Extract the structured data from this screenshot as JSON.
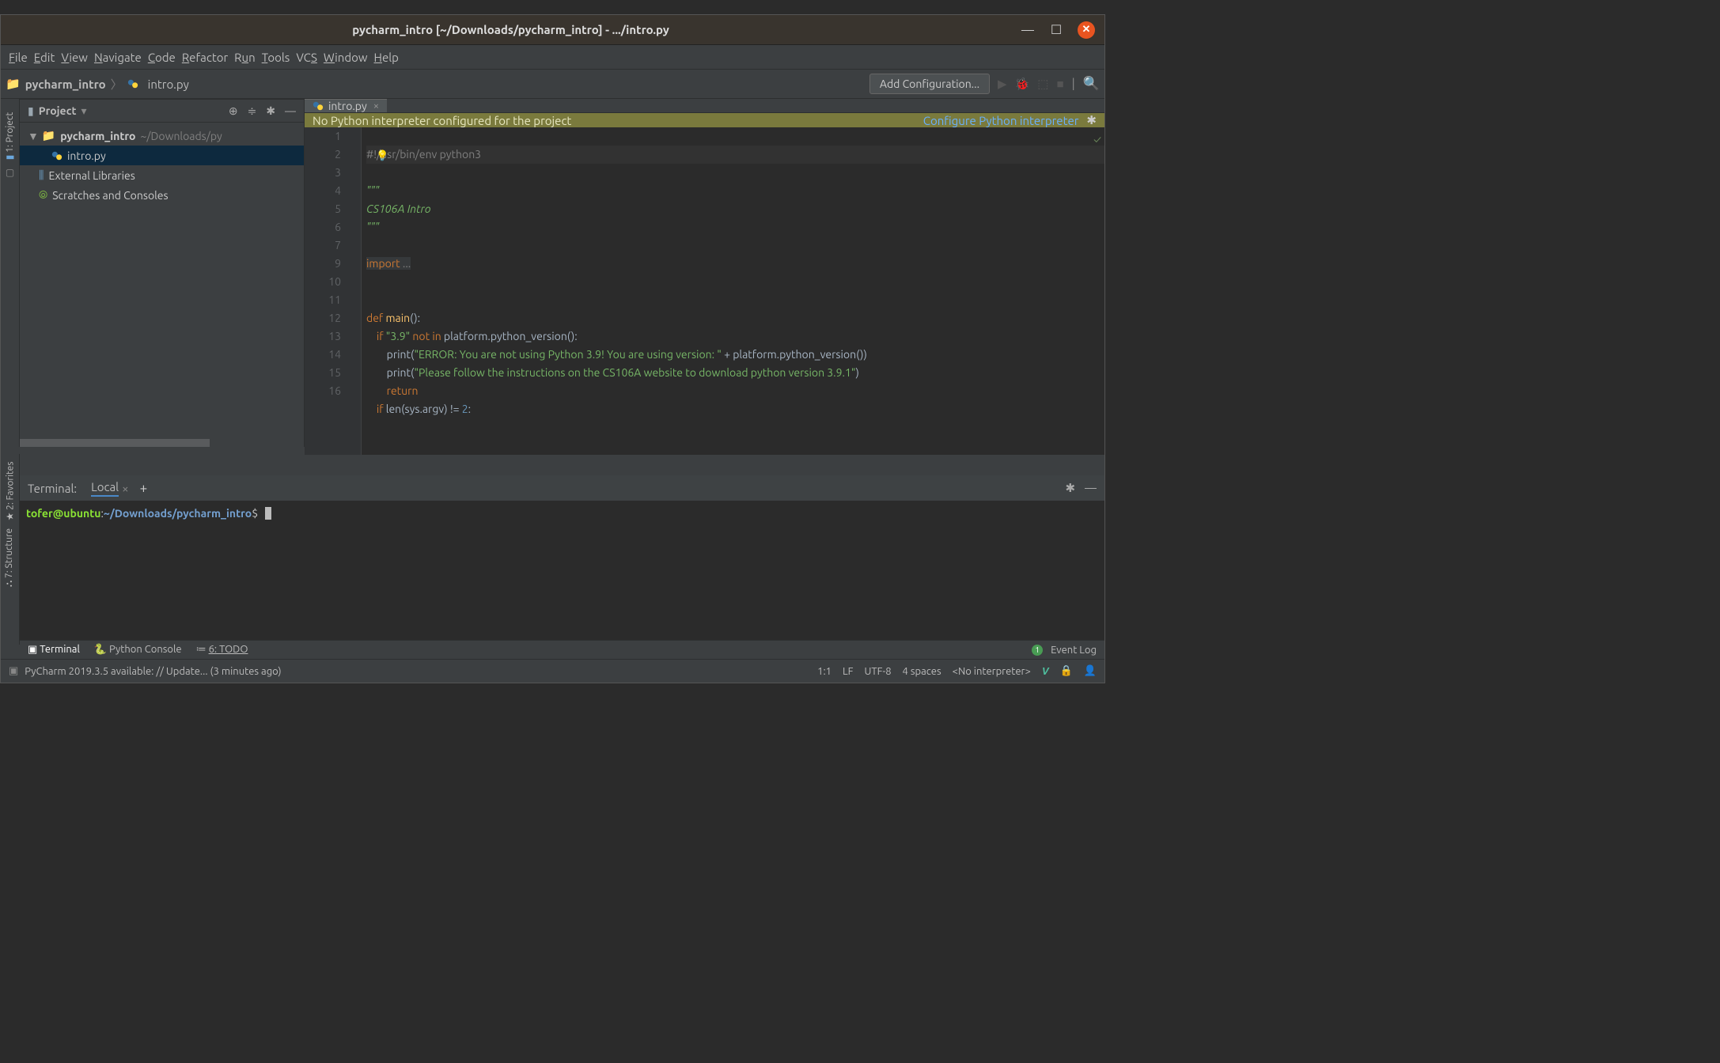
{
  "os_title": "pycharm_intro [~/Downloads/pycharm_intro] - .../intro.py",
  "menu": {
    "file": "File",
    "edit": "Edit",
    "view": "View",
    "navigate": "Navigate",
    "code": "Code",
    "refactor": "Refactor",
    "run": "Run",
    "tools": "Tools",
    "vcs": "VCS",
    "window": "Window",
    "help": "Help"
  },
  "breadcrumb": {
    "root": "pycharm_intro",
    "file": "intro.py"
  },
  "toolbar": {
    "add_config": "Add Configuration..."
  },
  "left_tabs": {
    "project": "1: Project",
    "favorites": "2: Favorites",
    "structure": "7: Structure"
  },
  "project_panel": {
    "title": "Project"
  },
  "tree": {
    "root_name": "pycharm_intro",
    "root_path": "~/Downloads/py",
    "file": "intro.py",
    "ext": "External Libraries",
    "scratches": "Scratches and Consoles"
  },
  "editor_tab": {
    "name": "intro.py"
  },
  "warn": {
    "msg": "No Python interpreter configured for the project",
    "link": "Configure Python interpreter"
  },
  "code_lines": {
    "l1": "#!/usr/bin/env python3",
    "l2": "",
    "l3": "\"\"\"",
    "l4": "CS106A Intro",
    "l5": "\"\"\"",
    "l6": "",
    "l7": "import ...",
    "l9": "",
    "l10": "",
    "l11_def": "def ",
    "l11_fn": "main",
    "l11_rest": "():",
    "l12_if": "    if ",
    "l12_str": "\"3.9\"",
    "l12_notin": " not in ",
    "l12_rest": "platform.python_version():",
    "l13_pre": "        print(",
    "l13_str": "\"ERROR: You are not using Python 3.9! You are using version: \"",
    "l13_mid": " + platform.python_version())",
    "l14_pre": "        print(",
    "l14_str": "\"Please follow the instructions on the CS106A website to download python version 3.9.1\"",
    "l14_post": ")",
    "l15_ret": "        return",
    "l16_if": "    if ",
    "l16_rest": "len(sys.argv) != ",
    "l16_num": "2",
    "l16_end": ":"
  },
  "gutter": [
    "1",
    "2",
    "3",
    "4",
    "5",
    "6",
    "7",
    "9",
    "10",
    "11",
    "12",
    "13",
    "14",
    "15",
    "16"
  ],
  "terminal": {
    "title": "Terminal:",
    "tab": "Local",
    "user": "tofer@ubuntu",
    "sep": ":",
    "path": "~/Downloads/pycharm_intro",
    "prompt": "$"
  },
  "bottom": {
    "terminal": "Terminal",
    "pyconsole": "Python Console",
    "todo": "6: TODO",
    "eventlog": "Event Log"
  },
  "status": {
    "msg": "PyCharm 2019.3.5 available: // Update... (3 minutes ago)",
    "pos": "1:1",
    "lf": "LF",
    "enc": "UTF-8",
    "indent": "4 spaces",
    "interp": "<No interpreter>"
  }
}
